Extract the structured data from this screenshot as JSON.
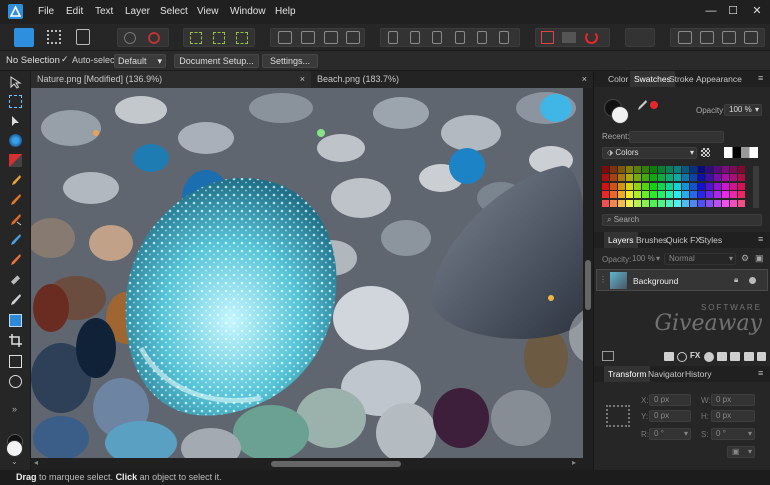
{
  "menu": [
    "File",
    "Edit",
    "Text",
    "Layer",
    "Select",
    "View",
    "Window",
    "Help"
  ],
  "window_controls": {
    "minimize": "—",
    "maximize": "☐",
    "close": "✕"
  },
  "context_bar": {
    "selection": "No Selection",
    "auto_select_label": "Auto-select:",
    "auto_select_value": "Default",
    "document_setup": "Document Setup...",
    "settings": "Settings..."
  },
  "tabs": [
    {
      "label": "Nature.png [Modified] (136.9%)",
      "close": "×"
    },
    {
      "label": "Beach.png (183.7%)",
      "close": "×"
    }
  ],
  "right_panel": {
    "top_tabs": [
      "Color",
      "Swatches",
      "Stroke",
      "Appearance"
    ],
    "active_top_tab": "Swatches",
    "opacity_label": "Opacity:",
    "opacity_value": "100 %",
    "recent_label": "Recent:",
    "palette_name": "Colors",
    "search_placeholder": "Search",
    "layers_tabs": [
      "Layers",
      "Brushes",
      "Quick FX",
      "Styles"
    ],
    "layers_opacity_label": "Opacity:",
    "layers_opacity_value": "100 %",
    "blend_mode": "Normal",
    "layer_name": "Background",
    "fx_label": "FX",
    "transform_tabs": [
      "Transform",
      "Navigator",
      "History"
    ],
    "transform": {
      "x_label": "X:",
      "x_value": "0 px",
      "y_label": "Y:",
      "y_value": "0 px",
      "w_label": "W:",
      "w_value": "0 px",
      "h_label": "H:",
      "h_value": "0 px",
      "r_label": "R:",
      "r_value": "0 °",
      "s_label": "S:",
      "s_value": "0 °"
    }
  },
  "watermark": {
    "line1": "SOFTWARE",
    "line2": "Giveaway"
  },
  "status": {
    "drag": "Drag",
    "mid": " to marquee select. ",
    "click": "Click",
    "end": " an object to select it."
  },
  "colors": {
    "accent": "#2d8fdd",
    "red": "#e8262b",
    "panel": "#262626"
  }
}
